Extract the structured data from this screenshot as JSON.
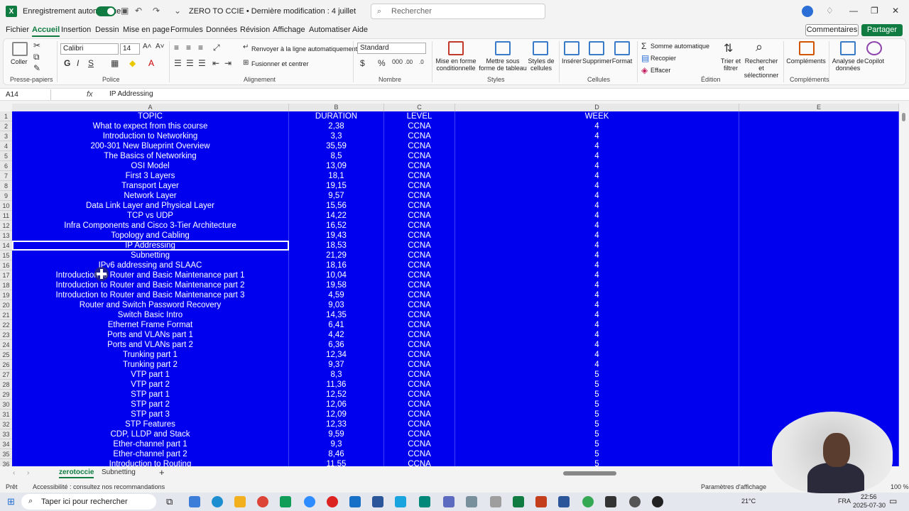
{
  "titlebar": {
    "app_icon": "X",
    "autosave_label": "Enregistrement automatique",
    "doc_title": "ZERO TO CCIE  •  Dernière modification : 4 juillet",
    "search_placeholder": "Rechercher"
  },
  "menu": [
    "Fichier",
    "Accueil",
    "Insertion",
    "Dessin",
    "Mise en page",
    "Formules",
    "Données",
    "Révision",
    "Affichage",
    "Automatiser",
    "Aide"
  ],
  "actions": {
    "comments": "Commentaires",
    "share": "Partager"
  },
  "ribbon": {
    "paste": "Coller",
    "font_name": "Calibri",
    "font_size": "14",
    "wrap_text": "Renvoyer à la ligne automatiquement",
    "merge_center": "Fusionner et centrer",
    "number_format": "Standard",
    "cond_format": "Mise en forme conditionnelle",
    "format_table": "Mettre sous forme de tableau",
    "cell_styles": "Styles de cellules",
    "insert": "Insérer",
    "delete": "Supprimer",
    "format": "Format",
    "autosum": "Somme automatique",
    "fill": "Recopier",
    "clear": "Effacer",
    "sort_filter": "Trier et filtrer",
    "find_select": "Rechercher et sélectionner",
    "addins": "Compléments",
    "analyze": "Analyse de données",
    "copilot": "Copilot",
    "groups": [
      "Presse-papiers",
      "Police",
      "Alignement",
      "Nombre",
      "Styles",
      "Cellules",
      "Édition",
      "Compléments"
    ]
  },
  "formula": {
    "name_box": "A14",
    "fx": "fx",
    "content": "IP Addressing"
  },
  "columns": [
    "A",
    "B",
    "C",
    "D",
    "E"
  ],
  "rows": [
    {
      "n": "1",
      "a": "TOPIC",
      "b": "DURATION",
      "c": "LEVEL",
      "d": "WEEK"
    },
    {
      "n": "2",
      "a": "What to expect from this course",
      "b": "2,38",
      "c": "CCNA",
      "d": "4"
    },
    {
      "n": "3",
      "a": "Introduction to Networking",
      "b": "3,3",
      "c": "CCNA",
      "d": "4"
    },
    {
      "n": "4",
      "a": "200-301 New Blueprint Overview",
      "b": "35,59",
      "c": "CCNA",
      "d": "4"
    },
    {
      "n": "5",
      "a": "The Basics of Networking",
      "b": "8,5",
      "c": "CCNA",
      "d": "4"
    },
    {
      "n": "6",
      "a": "OSI Model",
      "b": "13,09",
      "c": "CCNA",
      "d": "4"
    },
    {
      "n": "7",
      "a": "First 3 Layers",
      "b": "18,1",
      "c": "CCNA",
      "d": "4"
    },
    {
      "n": "8",
      "a": "Transport Layer",
      "b": "19,15",
      "c": "CCNA",
      "d": "4"
    },
    {
      "n": "9",
      "a": "Network Layer",
      "b": "9,57",
      "c": "CCNA",
      "d": "4"
    },
    {
      "n": "10",
      "a": "Data Link Layer and Physical Layer",
      "b": "15,56",
      "c": "CCNA",
      "d": "4"
    },
    {
      "n": "11",
      "a": "TCP vs UDP",
      "b": "14,22",
      "c": "CCNA",
      "d": "4"
    },
    {
      "n": "12",
      "a": "Infra Components and Cisco 3-Tier Architecture",
      "b": "16,52",
      "c": "CCNA",
      "d": "4"
    },
    {
      "n": "13",
      "a": "Topology and Cabling",
      "b": "19,43",
      "c": "CCNA",
      "d": "4"
    },
    {
      "n": "14",
      "a": "IP Addressing",
      "b": "18,53",
      "c": "CCNA",
      "d": "4"
    },
    {
      "n": "15",
      "a": "Subnetting",
      "b": "21,29",
      "c": "CCNA",
      "d": "4"
    },
    {
      "n": "16",
      "a": "IPv6 addressing and SLAAC",
      "b": "18,16",
      "c": "CCNA",
      "d": "4"
    },
    {
      "n": "17",
      "a": "Introduction to Router and Basic Maintenance part 1",
      "b": "10,04",
      "c": "CCNA",
      "d": "4"
    },
    {
      "n": "18",
      "a": "Introduction to Router and Basic Maintenance part 2",
      "b": "19,58",
      "c": "CCNA",
      "d": "4"
    },
    {
      "n": "19",
      "a": "Introduction to Router and Basic Maintenance part 3",
      "b": "4,59",
      "c": "CCNA",
      "d": "4"
    },
    {
      "n": "20",
      "a": "Router and Switch Password Recovery",
      "b": "9,03",
      "c": "CCNA",
      "d": "4"
    },
    {
      "n": "21",
      "a": "Switch Basic Intro",
      "b": "14,35",
      "c": "CCNA",
      "d": "4"
    },
    {
      "n": "22",
      "a": "Ethernet Frame Format",
      "b": "6,41",
      "c": "CCNA",
      "d": "4"
    },
    {
      "n": "23",
      "a": "Ports and VLANs part 1",
      "b": "4,42",
      "c": "CCNA",
      "d": "4"
    },
    {
      "n": "24",
      "a": "Ports and VLANs part 2",
      "b": "6,36",
      "c": "CCNA",
      "d": "4"
    },
    {
      "n": "25",
      "a": "Trunking part 1",
      "b": "12,34",
      "c": "CCNA",
      "d": "4"
    },
    {
      "n": "26",
      "a": "Trunking part 2",
      "b": "9,37",
      "c": "CCNA",
      "d": "4"
    },
    {
      "n": "27",
      "a": "VTP part 1",
      "b": "8,3",
      "c": "CCNA",
      "d": "5"
    },
    {
      "n": "28",
      "a": "VTP part 2",
      "b": "11,36",
      "c": "CCNA",
      "d": "5"
    },
    {
      "n": "29",
      "a": "STP part 1",
      "b": "12,52",
      "c": "CCNA",
      "d": "5"
    },
    {
      "n": "30",
      "a": "STP part 2",
      "b": "12,06",
      "c": "CCNA",
      "d": "5"
    },
    {
      "n": "31",
      "a": "STP part 3",
      "b": "12,09",
      "c": "CCNA",
      "d": "5"
    },
    {
      "n": "32",
      "a": "STP Features",
      "b": "12,33",
      "c": "CCNA",
      "d": "5"
    },
    {
      "n": "33",
      "a": "CDP, LLDP and Stack",
      "b": "9,59",
      "c": "CCNA",
      "d": "5"
    },
    {
      "n": "34",
      "a": "Ether-channel part 1",
      "b": "9,3",
      "c": "CCNA",
      "d": "5"
    },
    {
      "n": "35",
      "a": "Ether-channel part 2",
      "b": "8,46",
      "c": "CCNA",
      "d": "5"
    },
    {
      "n": "36",
      "a": "Introduction to Routing",
      "b": "11,55",
      "c": "CCNA",
      "d": "5"
    }
  ],
  "selected_row": "14",
  "sheets": {
    "active": "zerotoccie",
    "other": "Subnetting"
  },
  "status": {
    "ready": "Prêt",
    "accessibility": "Accessibilité : consultez nos recommandations",
    "display_settings": "Paramètres d'affichage",
    "zoom": "100 %"
  },
  "taskbar": {
    "search": "Taper ici pour rechercher",
    "weather": "21°C",
    "lang": "FRA",
    "time": "22:56",
    "date": "2025-07-30"
  },
  "colors": {
    "fill": "#0000ee",
    "accent": "#107c41"
  }
}
